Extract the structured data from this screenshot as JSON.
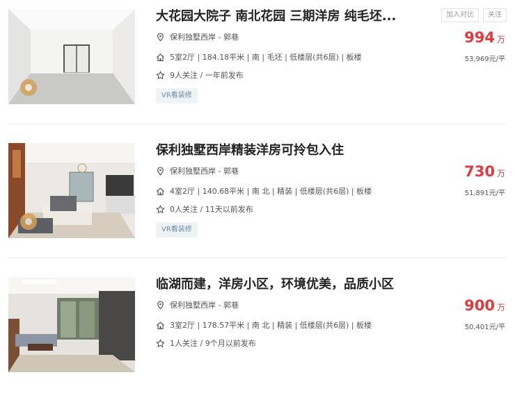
{
  "listings": [
    {
      "title": "大花园大院子 南北花园 三期洋房 纯毛坯...",
      "community": "保利独墅西岸 - 郭巷",
      "info": "5室2厅 | 184.18平米 | 南 | 毛坯 | 低楼层(共6层) | 板楼",
      "follow": "9人关注 / 一年前发布",
      "tag": "VR看装修",
      "price": "994",
      "price_unit": "万",
      "unit_price": "53,969元/平",
      "compare_label": "加入对比",
      "follow_label": "关注",
      "image_icon": "empty-room-photo"
    },
    {
      "title": "保利独墅西岸精装洋房可拎包入住",
      "community": "保利独墅西岸 - 郭巷",
      "info": "4室2厅 | 140.68平米 | 南 北 | 精装 | 低楼层(共6层) | 板楼",
      "follow": "0人关注 / 11天以前发布",
      "tag": "VR看装修",
      "price": "730",
      "price_unit": "万",
      "unit_price": "51,891元/平",
      "image_icon": "living-room-photo"
    },
    {
      "title": "临湖而建，洋房小区，环境优美，品质小区",
      "community": "保利独墅西岸 - 郭巷",
      "info": "3室2厅 | 178.57平米 | 南 北 | 精装 | 低楼层(共6层) | 板楼",
      "follow": "1人关注 / 9个月以前发布",
      "price": "900",
      "price_unit": "万",
      "unit_price": "50,401元/平",
      "image_icon": "living-room-photo"
    }
  ],
  "icons": {
    "location": "location-pin-icon",
    "house": "house-icon",
    "star": "star-icon"
  },
  "colors": {
    "price": "#e4393c",
    "tag_bg": "#eef3f7",
    "tag_text": "#6d8aa3"
  }
}
